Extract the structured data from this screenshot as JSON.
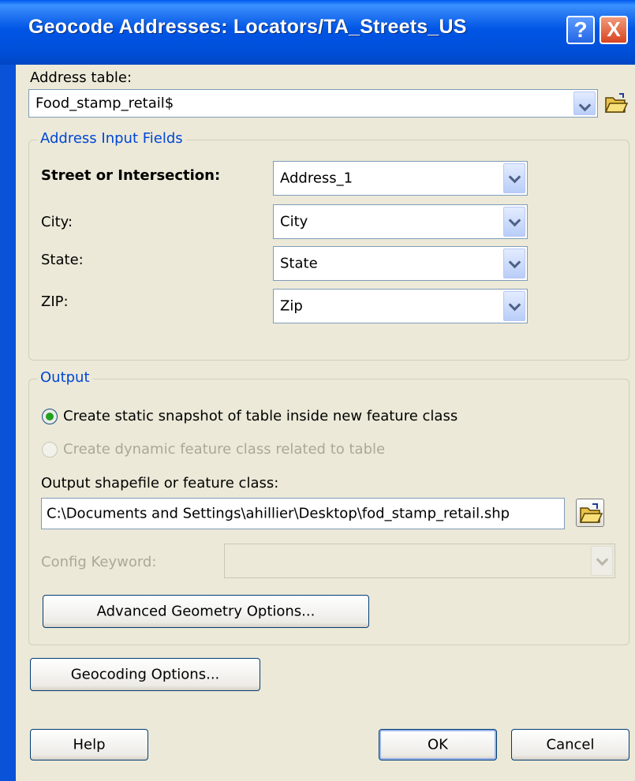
{
  "window": {
    "title": "Geocode Addresses:  Locators/TA_Streets_US",
    "help_glyph": "?",
    "close_glyph": "X"
  },
  "address_table": {
    "label": "Address table:",
    "value": "Food_stamp_retail$"
  },
  "input_fields": {
    "legend": "Address Input Fields",
    "rows": [
      {
        "label": "Street or Intersection:",
        "value": "Address_1"
      },
      {
        "label": "City:",
        "value": "City"
      },
      {
        "label": "State:",
        "value": "State"
      },
      {
        "label": "ZIP:",
        "value": "Zip"
      }
    ]
  },
  "output": {
    "legend": "Output",
    "option_static": "Create static snapshot of table inside new feature class",
    "option_dynamic": "Create dynamic feature class related to table",
    "selected": "static",
    "path_label": "Output shapefile or feature class:",
    "path_value": "C:\\Documents and Settings\\ahillier\\Desktop\\fod_stamp_retail.shp",
    "config_label": "Config Keyword:",
    "config_value": "",
    "advanced_button": "Advanced Geometry Options..."
  },
  "buttons": {
    "geocoding_options": "Geocoding Options...",
    "help": "Help",
    "ok": "OK",
    "cancel": "Cancel"
  },
  "icons": {
    "help": "help-icon",
    "close": "close-icon",
    "browse": "open-folder-icon",
    "dropdown": "chevron-down-icon"
  },
  "colors": {
    "titlebar": "#0055e5",
    "dialog_bg": "#ece9d8",
    "group_legend": "#0046d5",
    "close_button": "#d8431f",
    "radio_selected": "#21a121"
  }
}
